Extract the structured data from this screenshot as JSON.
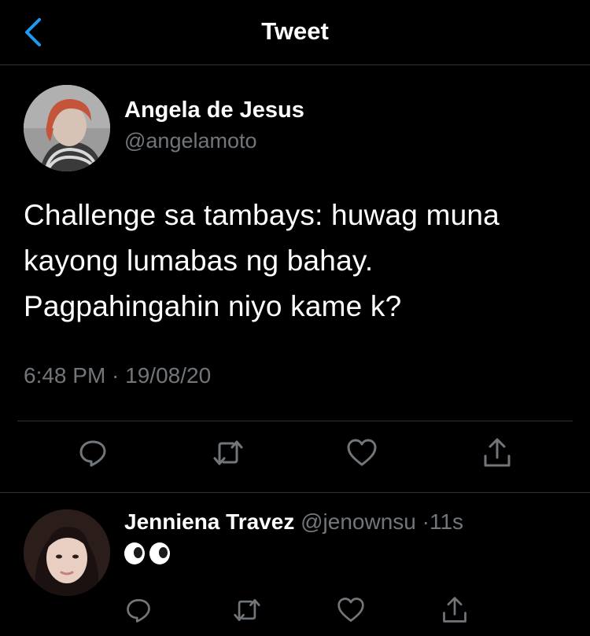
{
  "header": {
    "title": "Tweet",
    "back_icon": "chevron-left-icon"
  },
  "tweet": {
    "author_name": "Angela de Jesus",
    "author_handle": "@angelamoto",
    "text": "Challenge sa tambays: huwag muna kayong lumabas ng bahay. Pagpahingahin niyo kame k?",
    "timestamp": "6:48 PM · 19/08/20",
    "actions": [
      "reply-icon",
      "retweet-icon",
      "like-icon",
      "share-icon"
    ]
  },
  "reply": {
    "author_name": "Jenniena Travez",
    "author_handle": "@jenownsu",
    "separator": "·",
    "time": "11s",
    "emoji": "eyes-emoji",
    "actions": [
      "reply-icon",
      "retweet-icon",
      "like-icon",
      "share-icon"
    ]
  },
  "colors": {
    "accent": "#1d9bf0",
    "muted": "#71767b",
    "divider": "#2f3336",
    "background": "#000000"
  }
}
